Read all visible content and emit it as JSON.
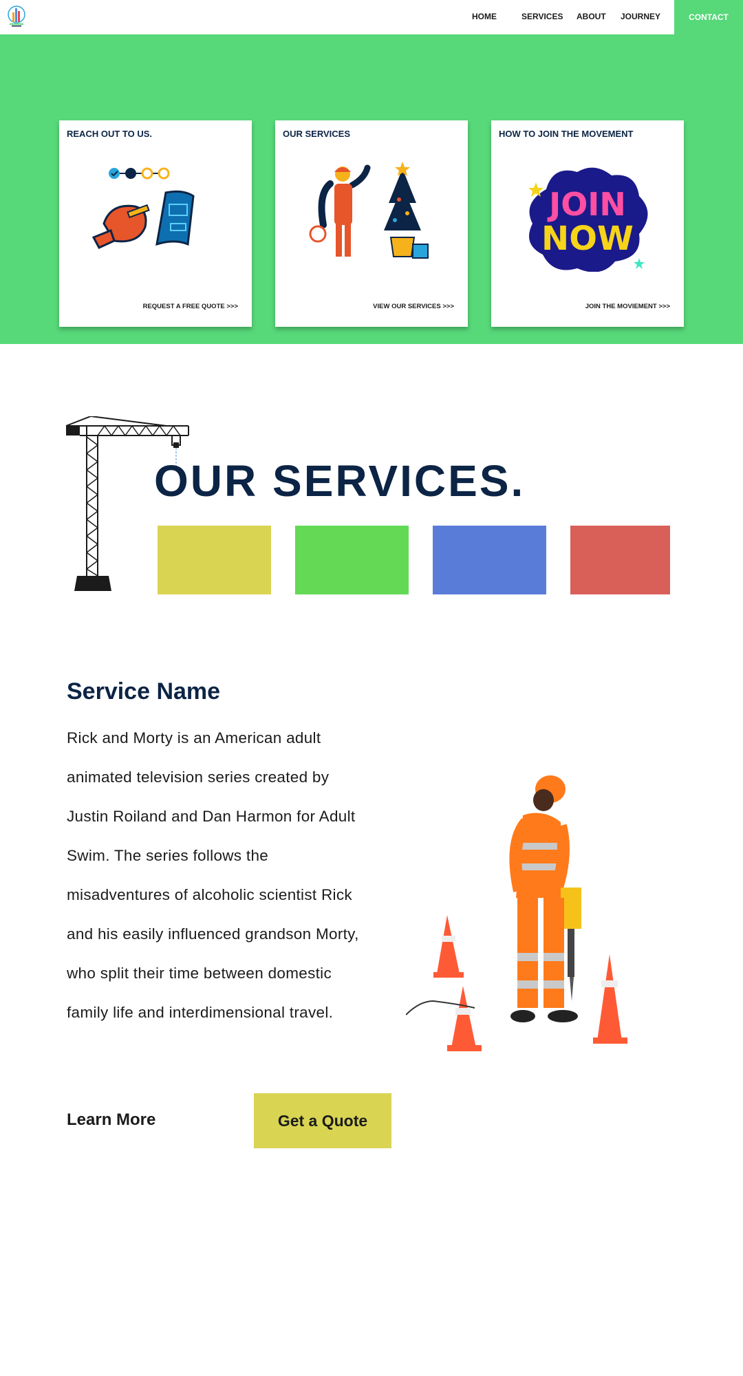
{
  "nav": {
    "items": [
      "HOME",
      "SERVICES",
      "ABOUT",
      "JOURNEY"
    ],
    "contact_label": "CONTACT"
  },
  "cards": [
    {
      "title": "REACH OUT TO US.",
      "link": "REQUEST A FREE QUOTE >>>",
      "icon": "quote-request-illustration"
    },
    {
      "title": "OUR SERVICES",
      "link": "VIEW OUR SERVICES >>>",
      "icon": "handyman-illustration"
    },
    {
      "title": "HOW TO JOIN THE MOVEMENT",
      "link": "JOIN THE MOVIEMENT >>>",
      "icon": "join-now-illustration"
    }
  ],
  "services": {
    "title": "OUR SERVICES.",
    "swatches": [
      "#d9d452",
      "#63d956",
      "#5a7cd9",
      "#d95f59"
    ]
  },
  "detail": {
    "name": "Service Name",
    "description": "Rick and Morty is an American adult animated television series created by Justin Roiland and Dan Harmon for Adult Swim. The series follows the misadventures of alcoholic scientist Rick and his easily influenced grandson Morty, who split their time between domestic family life and interdimensional travel.",
    "learn_more": "Learn More",
    "quote_button": "Get a Quote"
  },
  "colors": {
    "brand_green": "#57d879",
    "navy": "#0c2445",
    "accent_yellow": "#d9d452"
  }
}
